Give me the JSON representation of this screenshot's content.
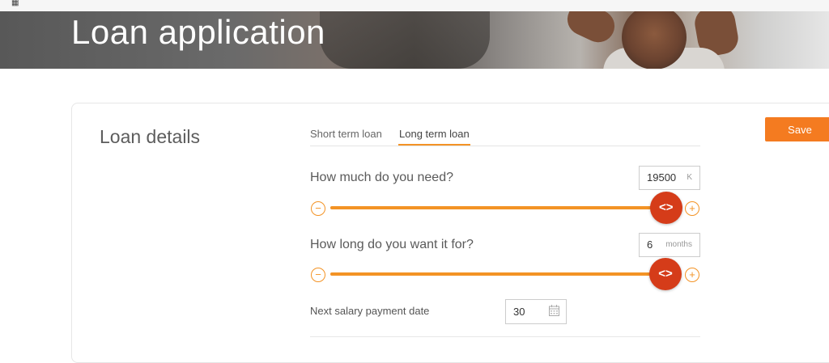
{
  "page": {
    "title": "Loan application"
  },
  "loan_details": {
    "section_title": "Loan details",
    "tabs": [
      {
        "label": "Short term loan",
        "active": false
      },
      {
        "label": "Long term loan",
        "active": true
      }
    ],
    "save_label": "Save",
    "amount": {
      "question": "How much do you need?",
      "value": "19500",
      "unit": "K",
      "slider_fraction": 0.96
    },
    "duration": {
      "question": "How long do you want it for?",
      "value": "6",
      "unit": "months",
      "slider_fraction": 1.0
    },
    "salary_date": {
      "label": "Next salary payment date",
      "value": "30"
    }
  },
  "colors": {
    "accent": "#f39325",
    "save_button": "#f47b20",
    "slider_thumb": "#d53c19"
  },
  "icons": {
    "minus": "minus-icon",
    "plus": "plus-icon",
    "thumb": "drag-arrows-icon",
    "calendar": "calendar-icon"
  }
}
